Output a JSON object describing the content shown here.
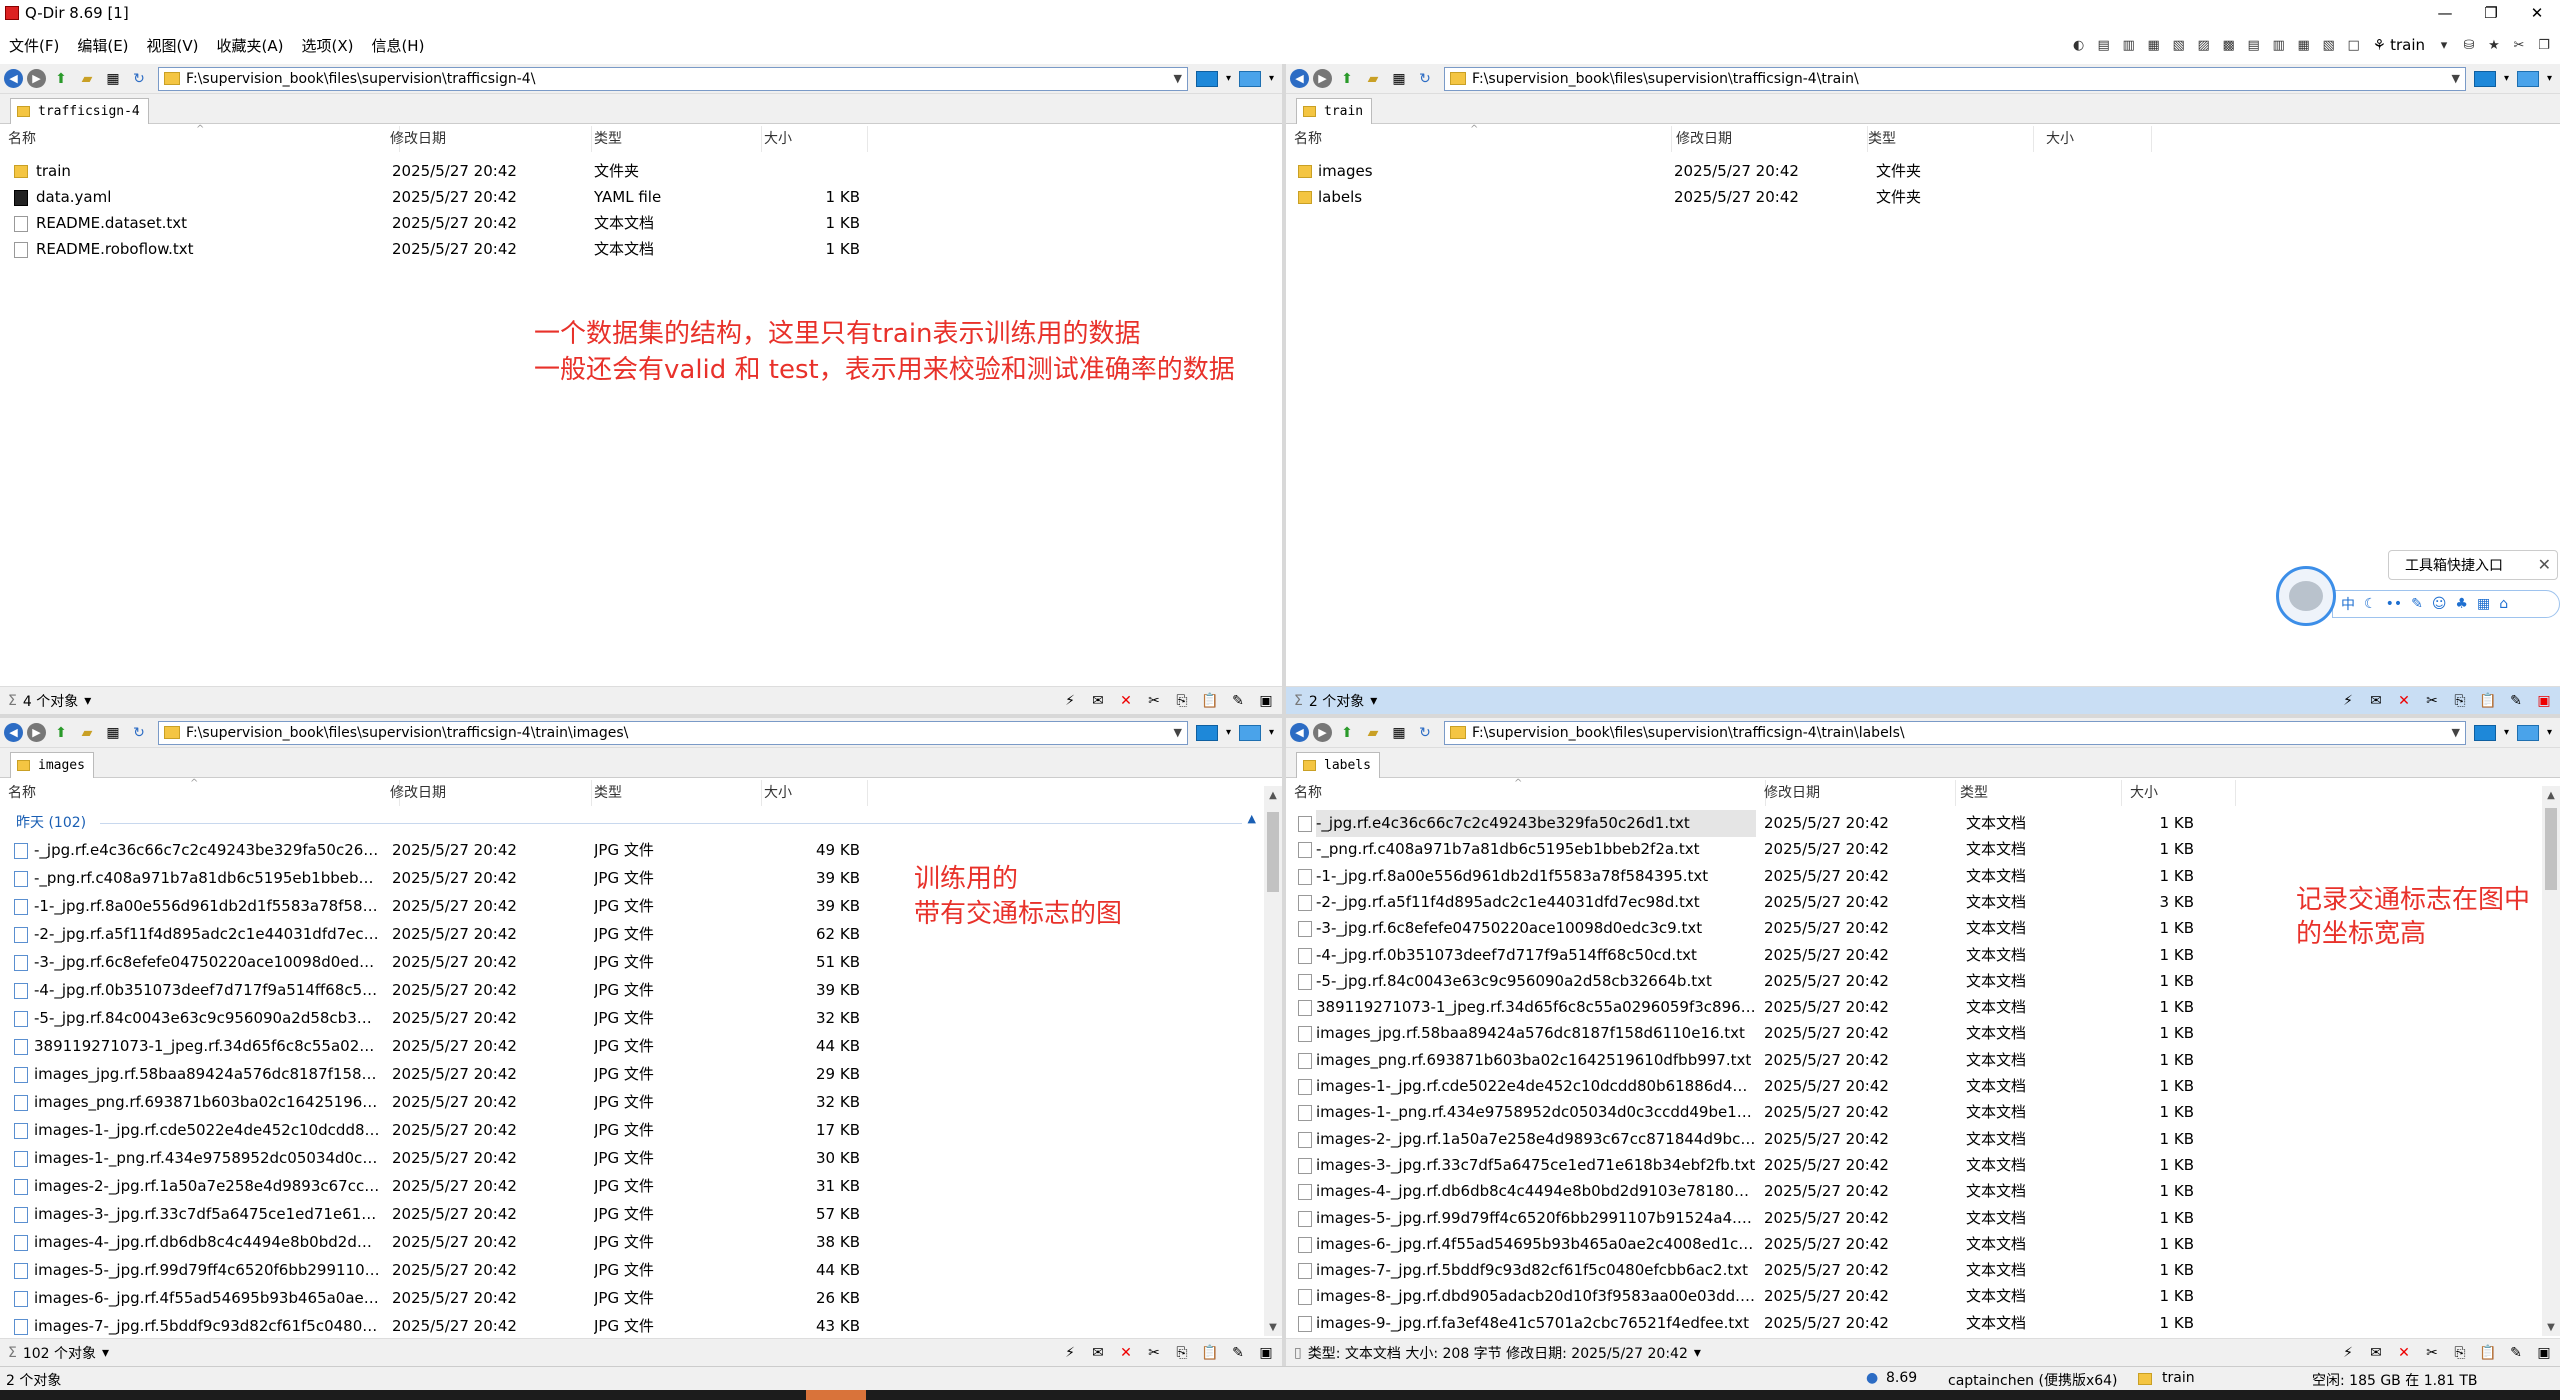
{
  "window": {
    "title": "Q-Dir 8.69 [1]",
    "min": "—",
    "restore": "❐",
    "close": "✕"
  },
  "menu": [
    "文件(F)",
    "编辑(E)",
    "视图(V)",
    "收藏夹(A)",
    "选项(X)",
    "信息(H)"
  ],
  "top_right": {
    "train_label": "train"
  },
  "columns": {
    "name": "名称",
    "date": "修改日期",
    "type": "类型",
    "size": "大小"
  },
  "panes": {
    "top_left": {
      "path": "F:\\supervision_book\\files\\supervision\\trafficsign-4\\",
      "tab": "trafficsign-4",
      "status": "4 个对象",
      "rows": [
        {
          "name": "train",
          "date": "2025/5/27 20:42",
          "type": "文件夹",
          "size": "",
          "icon": "folder-icon"
        },
        {
          "name": "data.yaml",
          "date": "2025/5/27 20:42",
          "type": "YAML file",
          "size": "1 KB",
          "icon": "yaml-file-icon"
        },
        {
          "name": "README.dataset.txt",
          "date": "2025/5/27 20:42",
          "type": "文本文档",
          "size": "1 KB",
          "icon": "text-file-icon"
        },
        {
          "name": "README.roboflow.txt",
          "date": "2025/5/27 20:42",
          "type": "文本文档",
          "size": "1 KB",
          "icon": "text-file-icon"
        }
      ]
    },
    "top_right": {
      "path": "F:\\supervision_book\\files\\supervision\\trafficsign-4\\train\\",
      "tab": "train",
      "status": "2 个对象",
      "rows": [
        {
          "name": "images",
          "date": "2025/5/27 20:42",
          "type": "文件夹",
          "size": "",
          "icon": "folder-icon"
        },
        {
          "name": "labels",
          "date": "2025/5/27 20:42",
          "type": "文件夹",
          "size": "",
          "icon": "folder-icon"
        }
      ]
    },
    "bottom_left": {
      "path": "F:\\supervision_book\\files\\supervision\\trafficsign-4\\train\\images\\",
      "tab": "images",
      "group": "昨天 (102)",
      "status": "102 个对象",
      "rows": [
        {
          "name": "-_jpg.rf.e4c36c66c7c2c49243be329fa50c26d1.j...",
          "date": "2025/5/27 20:42",
          "type": "JPG 文件",
          "size": "49 KB"
        },
        {
          "name": "-_png.rf.c408a971b7a81db6c5195eb1bbeb2f2...",
          "date": "2025/5/27 20:42",
          "type": "JPG 文件",
          "size": "39 KB"
        },
        {
          "name": "-1-_jpg.rf.8a00e556d961db2d1f5583a78f5843...",
          "date": "2025/5/27 20:42",
          "type": "JPG 文件",
          "size": "39 KB"
        },
        {
          "name": "-2-_jpg.rf.a5f11f4d895adc2c1e44031dfd7ec98...",
          "date": "2025/5/27 20:42",
          "type": "JPG 文件",
          "size": "62 KB"
        },
        {
          "name": "-3-_jpg.rf.6c8efefe04750220ace10098d0edc3c...",
          "date": "2025/5/27 20:42",
          "type": "JPG 文件",
          "size": "51 KB"
        },
        {
          "name": "-4-_jpg.rf.0b351073deef7d717f9a514ff68c50c...",
          "date": "2025/5/27 20:42",
          "type": "JPG 文件",
          "size": "39 KB"
        },
        {
          "name": "-5-_jpg.rf.84c0043e63c9c956090a2d58cb3266...",
          "date": "2025/5/27 20:42",
          "type": "JPG 文件",
          "size": "32 KB"
        },
        {
          "name": "389119271073-1_jpeg.rf.34d65f6c8c55a02960...",
          "date": "2025/5/27 20:42",
          "type": "JPG 文件",
          "size": "44 KB"
        },
        {
          "name": "images_jpg.rf.58baa89424a576dc8187f158d6...",
          "date": "2025/5/27 20:42",
          "type": "JPG 文件",
          "size": "29 KB"
        },
        {
          "name": "images_png.rf.693871b603ba02c1642519610...",
          "date": "2025/5/27 20:42",
          "type": "JPG 文件",
          "size": "32 KB"
        },
        {
          "name": "images-1-_jpg.rf.cde5022e4de452c10dcdd80...",
          "date": "2025/5/27 20:42",
          "type": "JPG 文件",
          "size": "17 KB"
        },
        {
          "name": "images-1-_png.rf.434e9758952dc05034d0c3c...",
          "date": "2025/5/27 20:42",
          "type": "JPG 文件",
          "size": "30 KB"
        },
        {
          "name": "images-2-_jpg.rf.1a50a7e258e4d9893c67cc87...",
          "date": "2025/5/27 20:42",
          "type": "JPG 文件",
          "size": "31 KB"
        },
        {
          "name": "images-3-_jpg.rf.33c7df5a6475ce1ed71e618b...",
          "date": "2025/5/27 20:42",
          "type": "JPG 文件",
          "size": "57 KB"
        },
        {
          "name": "images-4-_jpg.rf.db6db8c4c4494e8b0bd2d91...",
          "date": "2025/5/27 20:42",
          "type": "JPG 文件",
          "size": "38 KB"
        },
        {
          "name": "images-5-_jpg.rf.99d79ff4c6520f6bb2991107b...",
          "date": "2025/5/27 20:42",
          "type": "JPG 文件",
          "size": "44 KB"
        },
        {
          "name": "images-6-_jpg.rf.4f55ad54695b93b465a0ae2c...",
          "date": "2025/5/27 20:42",
          "type": "JPG 文件",
          "size": "26 KB"
        },
        {
          "name": "images-7-_jpg.rf.5bddf9c93d82cf61f5c0480ef...",
          "date": "2025/5/27 20:42",
          "type": "JPG 文件",
          "size": "43 KB"
        }
      ]
    },
    "bottom_right": {
      "path": "F:\\supervision_book\\files\\supervision\\trafficsign-4\\train\\labels\\",
      "tab": "labels",
      "status": "类型: 文本文档 大小: 208 字节 修改日期: 2025/5/27 20:42",
      "rows": [
        {
          "name": "-_jpg.rf.e4c36c66c7c2c49243be329fa50c26d1.txt",
          "date": "2025/5/27 20:42",
          "type": "文本文档",
          "size": "1 KB"
        },
        {
          "name": "-_png.rf.c408a971b7a81db6c5195eb1bbeb2f2a.txt",
          "date": "2025/5/27 20:42",
          "type": "文本文档",
          "size": "1 KB"
        },
        {
          "name": "-1-_jpg.rf.8a00e556d961db2d1f5583a78f584395.txt",
          "date": "2025/5/27 20:42",
          "type": "文本文档",
          "size": "1 KB"
        },
        {
          "name": "-2-_jpg.rf.a5f11f4d895adc2c1e44031dfd7ec98d.txt",
          "date": "2025/5/27 20:42",
          "type": "文本文档",
          "size": "3 KB"
        },
        {
          "name": "-3-_jpg.rf.6c8efefe04750220ace10098d0edc3c9.txt",
          "date": "2025/5/27 20:42",
          "type": "文本文档",
          "size": "1 KB"
        },
        {
          "name": "-4-_jpg.rf.0b351073deef7d717f9a514ff68c50cd.txt",
          "date": "2025/5/27 20:42",
          "type": "文本文档",
          "size": "1 KB"
        },
        {
          "name": "-5-_jpg.rf.84c0043e63c9c956090a2d58cb32664b.txt",
          "date": "2025/5/27 20:42",
          "type": "文本文档",
          "size": "1 KB"
        },
        {
          "name": "389119271073-1_jpeg.rf.34d65f6c8c55a0296059f3c896171...",
          "date": "2025/5/27 20:42",
          "type": "文本文档",
          "size": "1 KB"
        },
        {
          "name": "images_jpg.rf.58baa89424a576dc8187f158d6110e16.txt",
          "date": "2025/5/27 20:42",
          "type": "文本文档",
          "size": "1 KB"
        },
        {
          "name": "images_png.rf.693871b603ba02c1642519610dfbb997.txt",
          "date": "2025/5/27 20:42",
          "type": "文本文档",
          "size": "1 KB"
        },
        {
          "name": "images-1-_jpg.rf.cde5022e4de452c10dcdd80b61886d47.txt",
          "date": "2025/5/27 20:42",
          "type": "文本文档",
          "size": "1 KB"
        },
        {
          "name": "images-1-_png.rf.434e9758952dc05034d0c3ccdd49be1c.txt",
          "date": "2025/5/27 20:42",
          "type": "文本文档",
          "size": "1 KB"
        },
        {
          "name": "images-2-_jpg.rf.1a50a7e258e4d9893c67cc871844d9bc.txt",
          "date": "2025/5/27 20:42",
          "type": "文本文档",
          "size": "1 KB"
        },
        {
          "name": "images-3-_jpg.rf.33c7df5a6475ce1ed71e618b34ebf2fb.txt",
          "date": "2025/5/27 20:42",
          "type": "文本文档",
          "size": "1 KB"
        },
        {
          "name": "images-4-_jpg.rf.db6db8c4c4494e8b0bd2d9103e781800.txt",
          "date": "2025/5/27 20:42",
          "type": "文本文档",
          "size": "1 KB"
        },
        {
          "name": "images-5-_jpg.rf.99d79ff4c6520f6bb2991107b91524a4.txt",
          "date": "2025/5/27 20:42",
          "type": "文本文档",
          "size": "1 KB"
        },
        {
          "name": "images-6-_jpg.rf.4f55ad54695b93b465a0ae2c4008ed1c.txt",
          "date": "2025/5/27 20:42",
          "type": "文本文档",
          "size": "1 KB"
        },
        {
          "name": "images-7-_jpg.rf.5bddf9c93d82cf61f5c0480efcbb6ac2.txt",
          "date": "2025/5/27 20:42",
          "type": "文本文档",
          "size": "1 KB"
        },
        {
          "name": "images-8-_jpg.rf.dbd905adacb20d10f3f9583aa00e03dd.txt",
          "date": "2025/5/27 20:42",
          "type": "文本文档",
          "size": "1 KB"
        },
        {
          "name": "images-9-_jpg.rf.fa3ef48e41c5701a2cbc76521f4edfee.txt",
          "date": "2025/5/27 20:42",
          "type": "文本文档",
          "size": "1 KB"
        }
      ]
    }
  },
  "annotations": {
    "top_line1": "一个数据集的结构，这里只有train表示训练用的数据",
    "top_line2": "一般还会有valid 和 test，表示用来校验和测试准确率的数据",
    "images_line1": "训练用的",
    "images_line2": "带有交通标志的图",
    "labels_line1": "记录交通标志在图中",
    "labels_line2": "的坐标宽高"
  },
  "widget": {
    "bubble": "工具箱快捷入口",
    "bar_first": "中"
  },
  "bottombar": {
    "left": "2 个对象",
    "version": "8.69",
    "user": "captainchen (便携版x64)",
    "folder": "train",
    "disk": "空闲: 185 GB 在 1.81 TB"
  },
  "colors": {
    "accent": "#1e6fd0",
    "annotation": "#e8312a",
    "folder": "#f4c542"
  }
}
